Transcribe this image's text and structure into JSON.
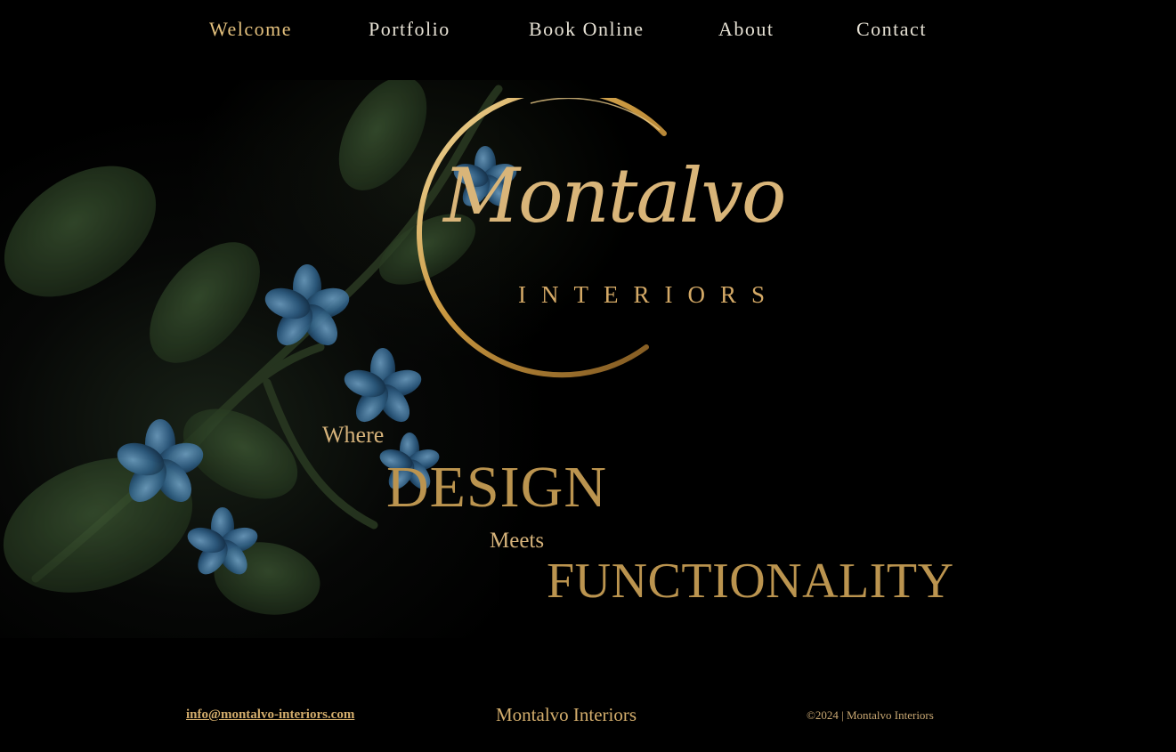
{
  "nav": {
    "items": [
      {
        "label": "Welcome",
        "active": true
      },
      {
        "label": "Portfolio",
        "active": false
      },
      {
        "label": "Book Online",
        "active": false
      },
      {
        "label": "About",
        "active": false
      },
      {
        "label": "Contact",
        "active": false
      }
    ],
    "active_color": "#e3c07d",
    "text_color": "#e6e1d4"
  },
  "logo": {
    "script": "Montalvo",
    "sub": "INTERIORS",
    "color": "#d9b579"
  },
  "tagline": {
    "where": "Where",
    "design": "DESIGN",
    "meets": "Meets",
    "functionality": "FUNCTIONALITY"
  },
  "hero": {
    "background_icon": "blue-flower-leaves-image"
  },
  "footer": {
    "email": "info@montalvo-interiors.com",
    "brand": "Montalvo Interiors",
    "copyright": "©2024 | Montalvo Interiors"
  },
  "colors": {
    "background": "#000000",
    "gold": "#bb944f",
    "light_gold": "#d5b27a"
  }
}
